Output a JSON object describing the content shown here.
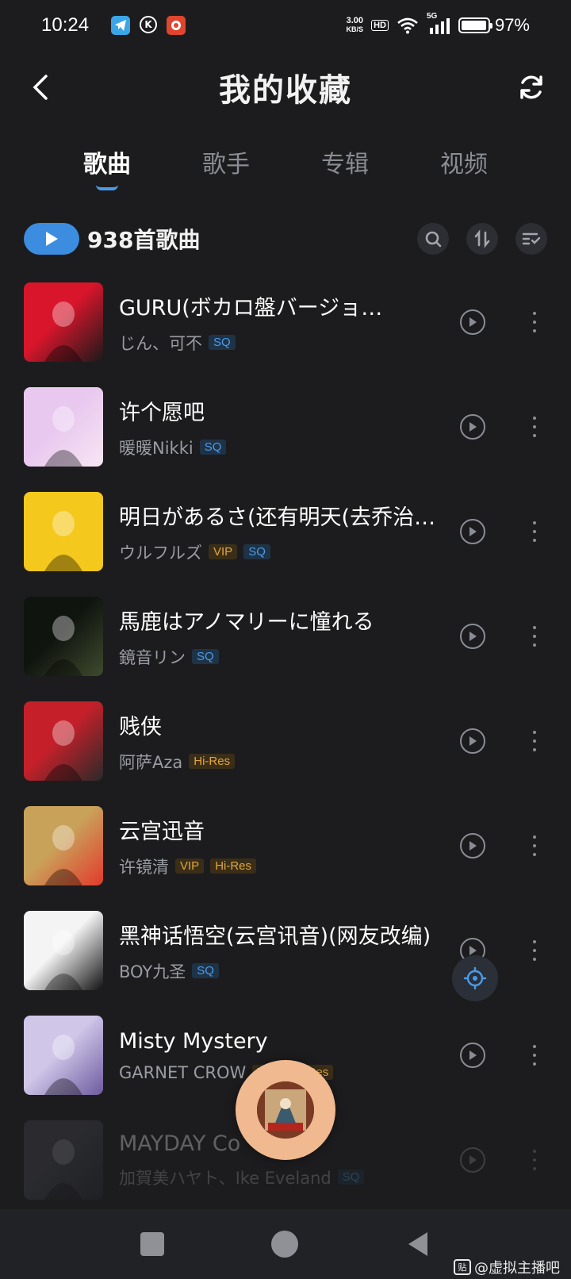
{
  "status_bar": {
    "time": "10:24",
    "net_speed_value": "3.00",
    "net_speed_unit": "KB/S",
    "hd": "HD",
    "signal_label": "5G",
    "battery": "97%",
    "battery_level": 0.97,
    "app_icon_k": "K"
  },
  "header": {
    "title": "我的收藏"
  },
  "tabs": [
    {
      "label": "歌曲",
      "active": true
    },
    {
      "label": "歌手",
      "active": false
    },
    {
      "label": "专辑",
      "active": false
    },
    {
      "label": "视频",
      "active": false
    }
  ],
  "toolbar": {
    "count_label": "938首歌曲"
  },
  "songs": [
    {
      "title": "GURU(ボカロ盤バージョ…",
      "artist": "じん、可不",
      "badges": [
        "SQ"
      ],
      "cover_colors": [
        "#d8152b",
        "#1a1a1a"
      ]
    },
    {
      "title": "许个愿吧",
      "artist": "暖暖Nikki",
      "badges": [
        "SQ"
      ],
      "cover_colors": [
        "#e9c8f0",
        "#f7e6f2"
      ]
    },
    {
      "title": "明日があるさ(还有明天(去乔治…",
      "artist": "ウルフルズ",
      "badges": [
        "VIP",
        "SQ"
      ],
      "cover_colors": [
        "#f4c81c",
        "#f4c81c"
      ]
    },
    {
      "title": "馬鹿はアノマリーに憧れる",
      "artist": "鏡音リン",
      "badges": [
        "SQ"
      ],
      "cover_colors": [
        "#10140f",
        "#3f4a2e"
      ]
    },
    {
      "title": "贱侠",
      "artist": "阿萨Aza",
      "badges": [
        "Hi-Res"
      ],
      "cover_colors": [
        "#c5202a",
        "#2a2a2a"
      ]
    },
    {
      "title": "云宫迅音",
      "artist": "许镜清",
      "badges": [
        "VIP",
        "Hi-Res"
      ],
      "cover_colors": [
        "#c9a25a",
        "#e23a2b"
      ]
    },
    {
      "title": "黑神话悟空(云宫讯音)(网友改编)",
      "artist": "BOY九圣",
      "badges": [
        "SQ"
      ],
      "cover_colors": [
        "#f4f4f4",
        "#111111"
      ]
    },
    {
      "title": "Misty Mystery",
      "artist": "GARNET CROW",
      "badges": [
        "VIP",
        "Hi-Res"
      ],
      "cover_colors": [
        "#cfc6e8",
        "#6d5aa0"
      ]
    },
    {
      "title": "MAYDAY Co",
      "artist": "加賀美ハヤト、Ike Eveland",
      "badges": [
        "SQ"
      ],
      "cover_colors": [
        "#4a4d58",
        "#2a2c33"
      ]
    }
  ],
  "bottom": {
    "watermark": "@虚拟主播吧",
    "watermark_icon": "贴"
  },
  "colors": {
    "accent": "#3c8de0",
    "background": "#1c1c1e",
    "sq": "#4a9be8",
    "vip": "#e1a63b"
  }
}
